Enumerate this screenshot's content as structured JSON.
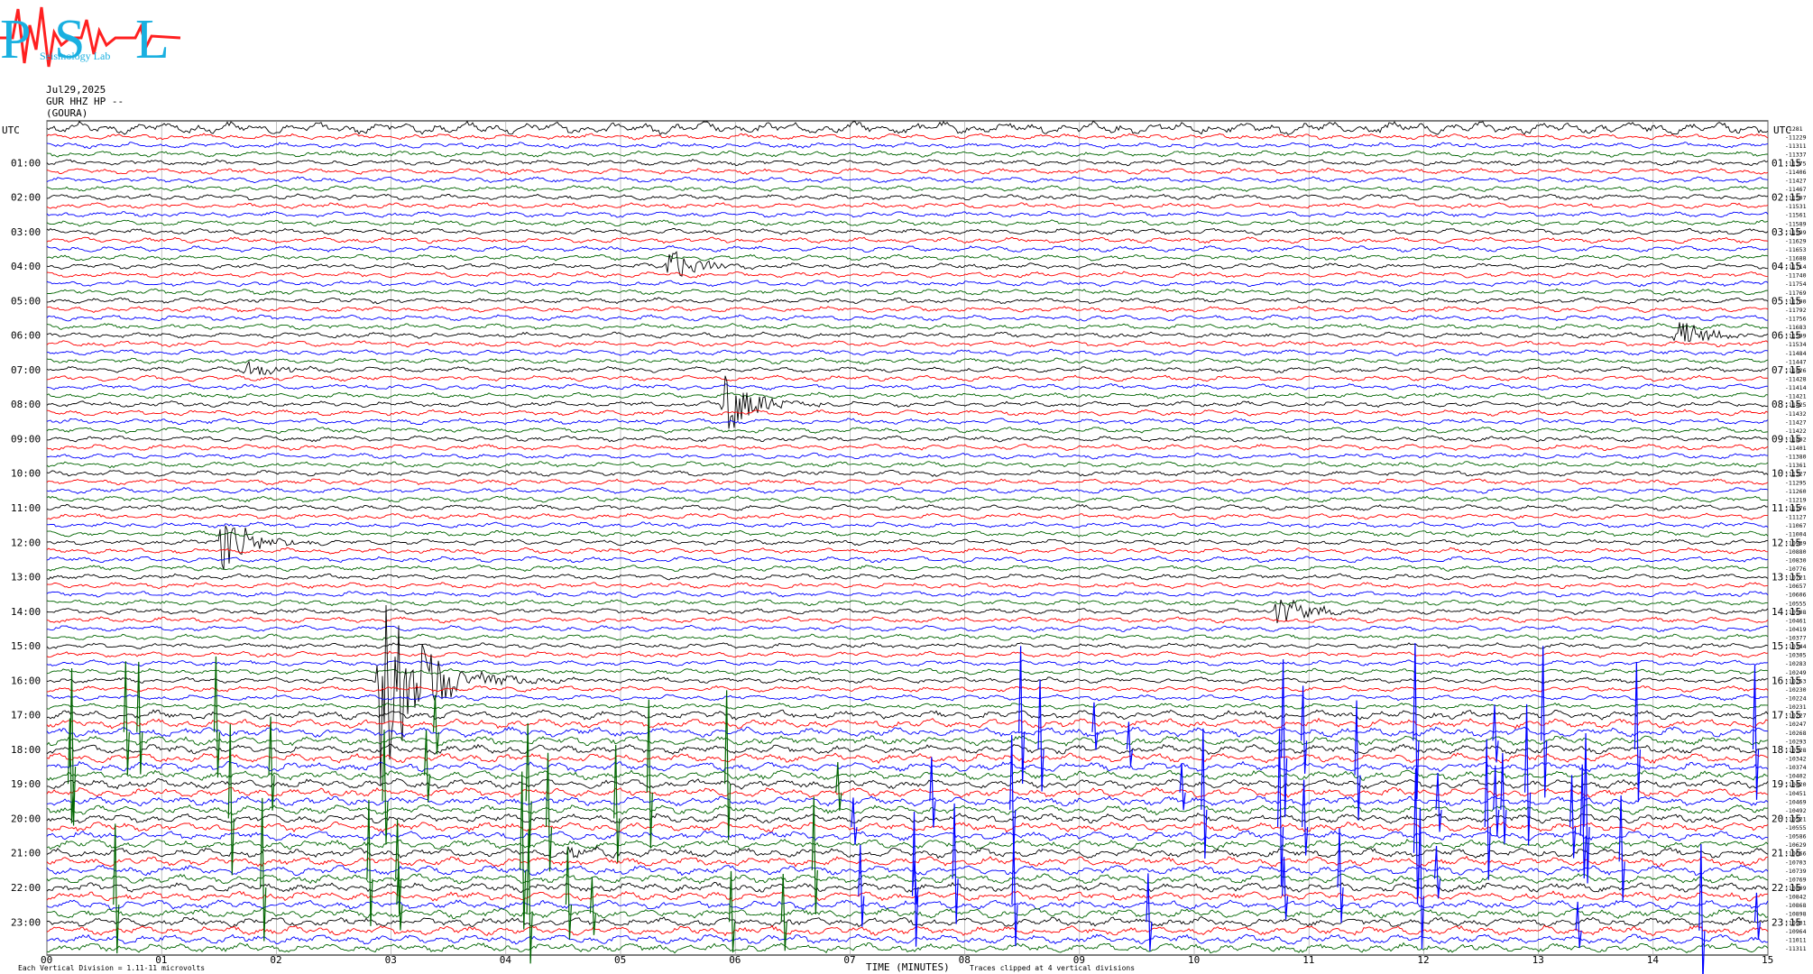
{
  "logo": {
    "letters": [
      "P",
      "S",
      "L"
    ],
    "subtitle": "Seismology Lab"
  },
  "header": {
    "date": "Jul29,2025",
    "station": "GUR HHZ HP --",
    "site": "(GOURA)"
  },
  "chart_data": {
    "type": "line",
    "title": "",
    "xlabel": "TIME (MINUTES)",
    "ylabel": "UTC",
    "xlim": [
      0,
      15
    ],
    "x_ticks": [
      "00",
      "01",
      "02",
      "03",
      "04",
      "05",
      "06",
      "07",
      "08",
      "09",
      "10",
      "11",
      "12",
      "13",
      "14",
      "15"
    ],
    "left_axis_title": "UTC",
    "right_axis_title": "UTC",
    "left_hour_labels": [
      "01:00",
      "02:00",
      "03:00",
      "04:00",
      "05:00",
      "06:00",
      "07:00",
      "08:00",
      "09:00",
      "10:00",
      "11:00",
      "12:00",
      "13:00",
      "14:00",
      "15:00",
      "16:00",
      "17:00",
      "18:00",
      "19:00",
      "20:00",
      "21:00",
      "22:00",
      "23:00"
    ],
    "right_hour_labels": [
      "01:15",
      "02:15",
      "03:15",
      "04:15",
      "05:15",
      "06:15",
      "07:15",
      "08:15",
      "09:15",
      "10:15",
      "11:15",
      "12:15",
      "13:15",
      "14:15",
      "15:15",
      "16:15",
      "17:15",
      "18:15",
      "19:15",
      "20:15",
      "21:15",
      "22:15",
      "23:15"
    ],
    "trace_count": 96,
    "trace_minutes": 15,
    "trace_colors": [
      "#000000",
      "#ff0000",
      "#0000ff",
      "#006400"
    ],
    "right_offsets": [
      "-1281",
      "-11229",
      "-11311",
      "-11337",
      "-11375",
      "-11406",
      "-11427",
      "-11467",
      "-11507",
      "-11531",
      "-11561",
      "-11589",
      "-11599",
      "-11629",
      "-11653",
      "-11688",
      "-11714",
      "-11740",
      "-11754",
      "-11769",
      "-11790",
      "-11792",
      "-11756",
      "-11683",
      "-11599",
      "-11534",
      "-11484",
      "-11447",
      "-11426",
      "-11428",
      "-11414",
      "-11421",
      "-11425",
      "-11432",
      "-11427",
      "-11422",
      "-11402",
      "-11401",
      "-11380",
      "-11361",
      "-11327",
      "-11295",
      "-11260",
      "-11219",
      "-11176",
      "-11127",
      "-11067",
      "-11004",
      "-10939",
      "-10880",
      "-10830",
      "-10776",
      "-10721",
      "-10657",
      "-10606",
      "-10555",
      "-10508",
      "-10461",
      "-10419",
      "-10377",
      "-10344",
      "-10305",
      "-10283",
      "-10249",
      "-10253",
      "-10230",
      "-10224",
      "-10231",
      "-10227",
      "-10247",
      "-10268",
      "-10293",
      "-10328",
      "-10342",
      "-10374",
      "-10402",
      "-10420",
      "-10451",
      "-10469",
      "-10492",
      "-10521",
      "-10555",
      "-10586",
      "-10629",
      "-10666",
      "-10703",
      "-10739",
      "-10769",
      "-10809",
      "-10842",
      "-10868",
      "-10898",
      "-10931",
      "-10964",
      "-11011",
      "-11311"
    ],
    "events": [
      {
        "label": "local event",
        "trace_hour": "04:00",
        "minute": 5.4,
        "amplitude": "medium"
      },
      {
        "label": "regional event",
        "trace_hour": "06:00",
        "minute": 14.2,
        "amplitude": "medium"
      },
      {
        "label": "local event",
        "trace_hour": "07:00",
        "minute": 1.7,
        "amplitude": "small"
      },
      {
        "label": "teleseism",
        "trace_hour": "08:00",
        "minute": 5.9,
        "amplitude": "large"
      },
      {
        "label": "noise burst",
        "trace_hour": "12:00",
        "minute": 1.5,
        "amplitude": "large"
      },
      {
        "label": "regional event",
        "trace_hour": "14:00",
        "minute": 10.7,
        "amplitude": "medium"
      },
      {
        "label": "large event",
        "trace_hour": "16:00",
        "minute": 2.9,
        "amplitude": "very large"
      },
      {
        "label": "local event",
        "trace_hour": "21:00",
        "minute": 4.5,
        "amplitude": "small"
      }
    ],
    "grid": true,
    "footer_left": "Each Vertical Division = 1.11-11 microvolts",
    "footer_center": "TIME (MINUTES)",
    "footer_note": "Traces clipped at 4 vertical divisions"
  }
}
